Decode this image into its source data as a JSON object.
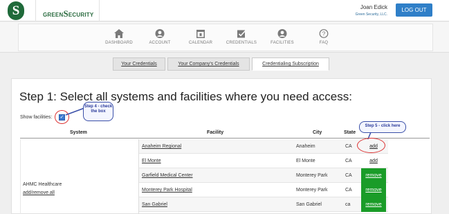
{
  "header": {
    "brand": "GREEN",
    "brand_mark": "S",
    "brand_rest": "ECURITY",
    "user_name": "Joan Edick",
    "user_org": "Green Security, LLC.",
    "logout_label": "LOG OUT"
  },
  "nav": {
    "items": [
      {
        "label": "DASHBOARD",
        "icon": "home-icon"
      },
      {
        "label": "ACCOUNT",
        "icon": "user-icon"
      },
      {
        "label": "CALENDAR",
        "icon": "calendar-icon"
      },
      {
        "label": "CREDENTIALS",
        "icon": "checkmark-icon"
      },
      {
        "label": "FACILITIES",
        "icon": "building-icon"
      },
      {
        "label": "FAQ",
        "icon": "question-icon"
      }
    ]
  },
  "tabs": [
    {
      "label": "Your Credentials",
      "active": false
    },
    {
      "label": "Your Company's Credentials",
      "active": false
    },
    {
      "label": "Credentialing Subscription",
      "active": true
    }
  ],
  "main": {
    "heading": "Step 1: Select all systems and facilities where you need access:",
    "show_facilities_label": "Show facilities:",
    "show_facilities_checked": true
  },
  "callouts": {
    "step4": "Step 4 - check the box",
    "step5": "Step 5 - click here"
  },
  "table": {
    "headers": {
      "system": "System",
      "facility": "Facility",
      "city": "City",
      "state": "State"
    },
    "system": {
      "name": "AHMC Healthcare",
      "link": "add/remove all"
    },
    "rows": [
      {
        "facility": "Anaheim Regional",
        "city": "Anaheim",
        "state": "CA",
        "action": "add"
      },
      {
        "facility": "El Monte",
        "city": "El Monte",
        "state": "CA",
        "action": "add"
      },
      {
        "facility": "Garfield Medical Center",
        "city": "Monterey Park",
        "state": "CA",
        "action": "remove"
      },
      {
        "facility": "Monterey Park Hospital",
        "city": "Monterey Park",
        "state": "CA",
        "action": "remove"
      },
      {
        "facility": "San Gabriel",
        "city": "San Gabriel",
        "state": "ca",
        "action": "remove"
      }
    ]
  },
  "colors": {
    "brand_green": "#1f6a3a",
    "logout_blue": "#2f7fc8",
    "remove_green": "#1a9c28",
    "callout_border": "#3a4fa8",
    "highlight_red": "#d33333"
  }
}
